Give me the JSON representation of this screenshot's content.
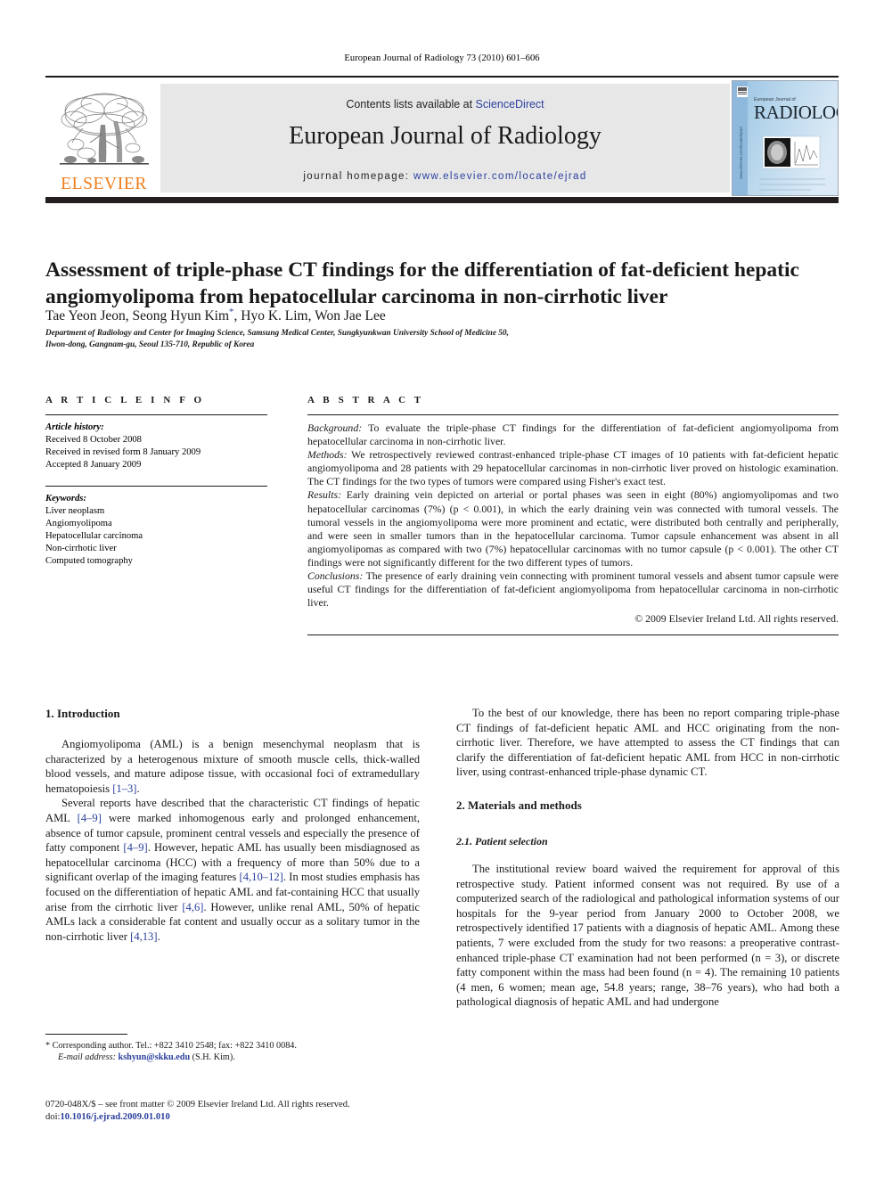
{
  "running_head": "European Journal of Radiology 73 (2010) 601–606",
  "masthead": {
    "publisher_name": "ELSEVIER",
    "publisher_logo_icon": "elsevier-tree-icon",
    "contents_prefix": "Contents lists available at ",
    "contents_link": "ScienceDirect",
    "journal_title": "European Journal of Radiology",
    "homepage_prefix": "journal homepage: ",
    "homepage_url": "www.elsevier.com/locate/ejrad",
    "cover": {
      "publisher_mark": "ELSEVIER",
      "overline": "European Journal of",
      "title": "RADIOLOGY",
      "spine_url": "www.elsevier.com/locate/ejrad"
    }
  },
  "article": {
    "title": "Assessment of triple-phase CT findings for the differentiation of fat-deficient hepatic angiomyolipoma from hepatocellular carcinoma in non-cirrhotic liver",
    "authors": "Tae Yeon Jeon, Seong Hyun Kim, Hyo K. Lim, Won Jae Lee",
    "corresponding_marker": "*",
    "affiliation_line1": "Department of Radiology and Center for Imaging Science, Samsung Medical Center, Sungkyunkwan University School of Medicine 50,",
    "affiliation_line2": "Ilwon-dong, Gangnam-gu, Seoul 135-710, Republic of Korea"
  },
  "article_info": {
    "heading": "A R T I C L E    I N F O",
    "history_label": "Article history:",
    "history": [
      "Received 8 October 2008",
      "Received in revised form 8 January 2009",
      "Accepted 8 January 2009"
    ],
    "keywords_label": "Keywords:",
    "keywords": [
      "Liver neoplasm",
      "Angiomyolipoma",
      "Hepatocellular carcinoma",
      "Non-cirrhotic liver",
      "Computed tomography"
    ]
  },
  "abstract": {
    "heading": "A B S T R A C T",
    "background_label": "Background:",
    "background_text": " To evaluate the triple-phase CT findings for the differentiation of fat-deficient angiomyolipoma from hepatocellular carcinoma in non-cirrhotic liver.",
    "methods_label": "Methods:",
    "methods_text": " We retrospectively reviewed contrast-enhanced triple-phase CT images of 10 patients with fat-deficient hepatic angiomyolipoma and 28 patients with 29 hepatocellular carcinomas in non-cirrhotic liver proved on histologic examination. The CT findings for the two types of tumors were compared using Fisher's exact test.",
    "results_label": "Results:",
    "results_text": " Early draining vein depicted on arterial or portal phases was seen in eight (80%) angiomyolipomas and two hepatocellular carcinomas (7%) (p < 0.001), in which the early draining vein was connected with tumoral vessels. The tumoral vessels in the angiomyolipoma were more prominent and ectatic, were distributed both centrally and peripherally, and were seen in smaller tumors than in the hepatocellular carcinoma. Tumor capsule enhancement was absent in all angiomyolipomas as compared with two (7%) hepatocellular carcinomas with no tumor capsule (p < 0.001). The other CT findings were not significantly different for the two different types of tumors.",
    "conclusions_label": "Conclusions:",
    "conclusions_text": " The presence of early draining vein connecting with prominent tumoral vessels and absent tumor capsule were useful CT findings for the differentiation of fat-deficient angiomyolipoma from hepatocellular carcinoma in non-cirrhotic liver.",
    "copyright": "© 2009 Elsevier Ireland Ltd. All rights reserved."
  },
  "body": {
    "intro_heading": "1.  Introduction",
    "intro_p1_a": "Angiomyolipoma (AML) is a benign mesenchymal neoplasm that is characterized by a heterogenous mixture of smooth muscle cells, thick-walled blood vessels, and mature adipose tissue, with occasional foci of extramedullary hematopoiesis ",
    "intro_p1_ref": "[1–3]",
    "intro_p1_b": ".",
    "intro_p2_a": "Several reports have described that the characteristic CT findings of hepatic AML ",
    "intro_p2_ref1": "[4–9]",
    "intro_p2_b": " were marked inhomogenous early and prolonged enhancement, absence of tumor capsule, prominent central vessels and especially the presence of fatty component ",
    "intro_p2_ref2": "[4–9]",
    "intro_p2_c": ". However, hepatic AML has usually been misdiagnosed as hepatocellular carcinoma (HCC) with a frequency of more than 50% due to a significant overlap of the imaging features ",
    "intro_p2_ref3": "[4,10–12]",
    "intro_p2_d": ". In most studies emphasis has focused on the differentiation of hepatic AML and fat-containing HCC that usually arise from the cirrhotic liver ",
    "intro_p2_ref4": "[4,6]",
    "intro_p2_e": ". However, unlike renal AML, 50% of hepatic AMLs lack a considerable fat content and usually occur as a solitary tumor in the non-cirrhotic liver ",
    "intro_p2_ref5": "[4,13]",
    "intro_p2_f": ".",
    "right_p1": "To the best of our knowledge, there has been no report comparing triple-phase CT findings of fat-deficient hepatic AML and HCC originating from the non-cirrhotic liver. Therefore, we have attempted to assess the CT findings that can clarify the differentiation of fat-deficient hepatic AML from HCC in non-cirrhotic liver, using contrast-enhanced triple-phase dynamic CT.",
    "methods_heading": "2.  Materials and methods",
    "patient_selection_heading": "2.1.  Patient selection",
    "patient_selection_p": "The institutional review board waived the requirement for approval of this retrospective study. Patient informed consent was not required. By use of a computerized search of the radiological and pathological information systems of our hospitals for the 9-year period from January 2000 to October 2008, we retrospectively identified 17 patients with a diagnosis of hepatic AML. Among these patients, 7 were excluded from the study for two reasons: a preoperative contrast-enhanced triple-phase CT examination had not been performed (n = 3), or discrete fatty component within the mass had been found (n = 4). The remaining 10 patients (4 men, 6 women; mean age, 54.8 years; range, 38–76 years), who had both a pathological diagnosis of hepatic AML and had undergone"
  },
  "footnote": {
    "marker": "*",
    "corresponding_text": " Corresponding author. Tel.: +822 3410 2548; fax: +822 3410 0084.",
    "email_label": "E-mail address:",
    "email": "kshyun@skku.edu",
    "email_suffix": " (S.H. Kim)."
  },
  "footer": {
    "issn_line": "0720-048X/$ – see front matter © 2009 Elsevier Ireland Ltd. All rights reserved.",
    "doi_label": "doi:",
    "doi": "10.1016/j.ejrad.2009.01.010"
  },
  "colors": {
    "link": "#2a3f9d",
    "elsevier_orange": "#ef7d1a",
    "rule": "#231f20",
    "band_bg": "#e7e7e8"
  }
}
